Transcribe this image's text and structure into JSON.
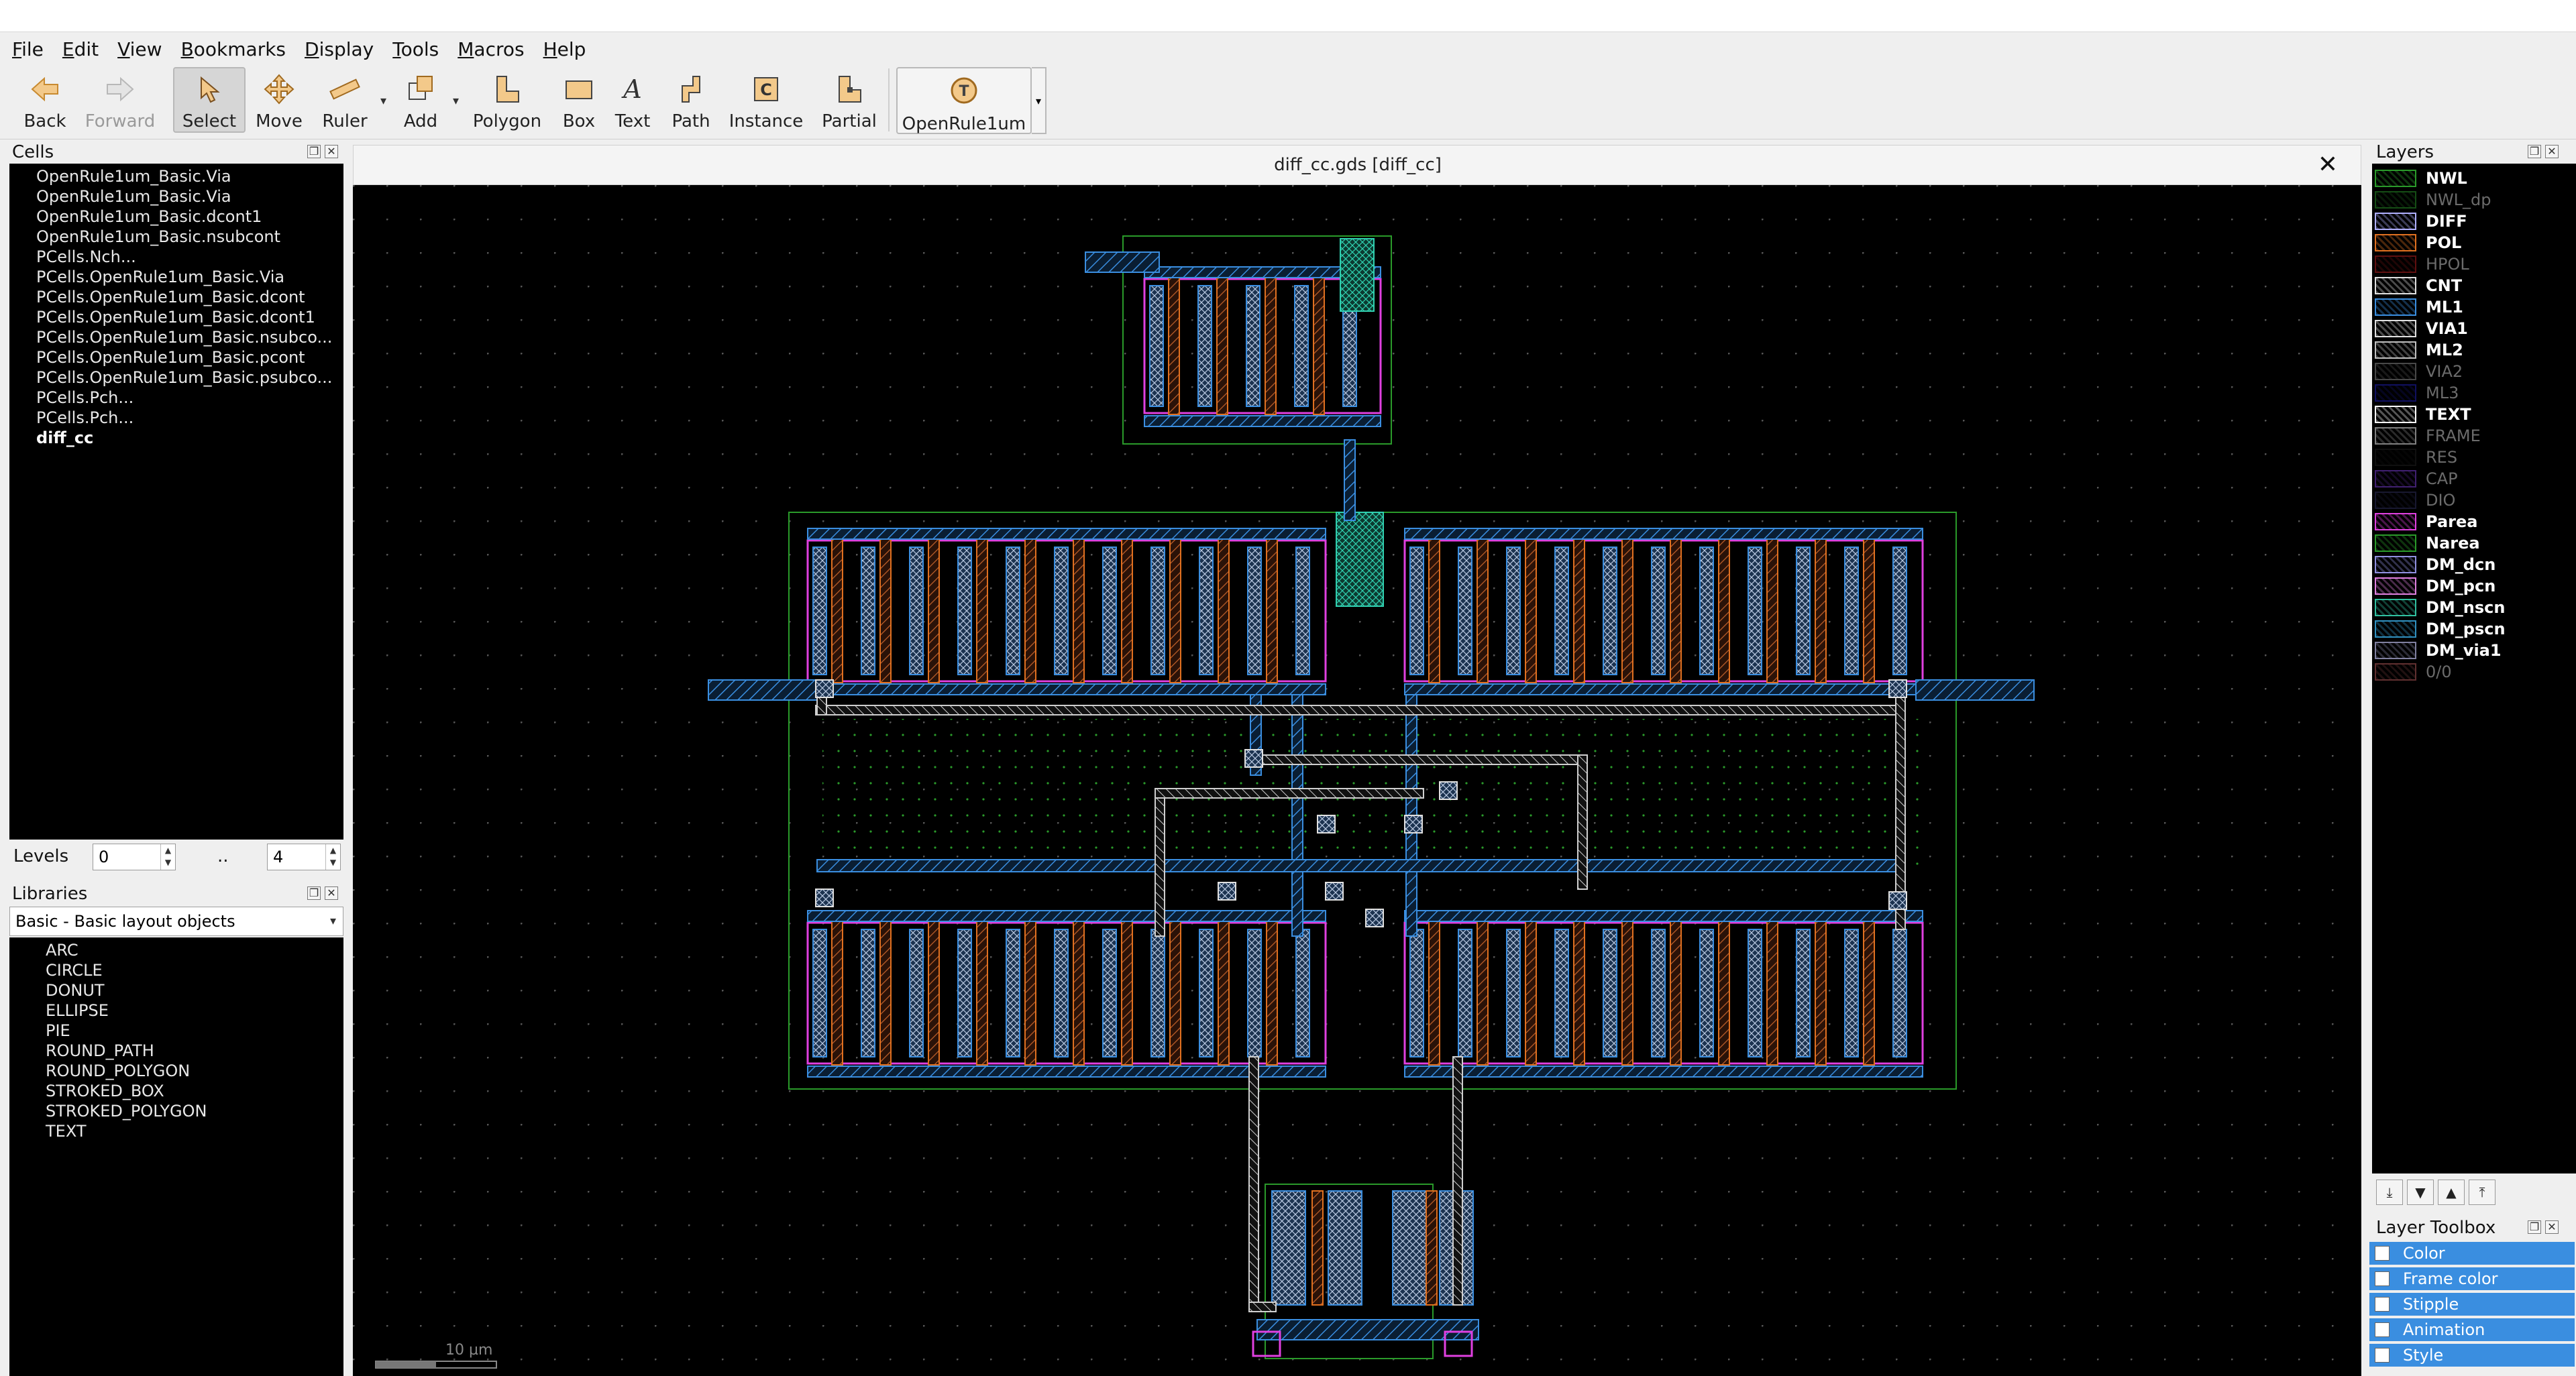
{
  "menu": [
    "File",
    "Edit",
    "View",
    "Bookmarks",
    "Display",
    "Tools",
    "Macros",
    "Help"
  ],
  "toolbar": {
    "back": "Back",
    "forward": "Forward",
    "select": "Select",
    "move": "Move",
    "ruler": "Ruler",
    "add": "Add",
    "polygon": "Polygon",
    "box": "Box",
    "text": "Text",
    "path": "Path",
    "instance": "Instance",
    "partial": "Partial",
    "tech": "OpenRule1um"
  },
  "cells_panel": {
    "title": "Cells",
    "items": [
      "OpenRule1um_Basic.Via",
      "OpenRule1um_Basic.Via",
      "OpenRule1um_Basic.dcont1",
      "OpenRule1um_Basic.nsubcont",
      "PCells.Nch...",
      "PCells.OpenRule1um_Basic.Via",
      "PCells.OpenRule1um_Basic.dcont",
      "PCells.OpenRule1um_Basic.dcont1",
      "PCells.OpenRule1um_Basic.nsubco...",
      "PCells.OpenRule1um_Basic.pcont",
      "PCells.OpenRule1um_Basic.psubco...",
      "PCells.Pch...",
      "PCells.Pch...",
      "diff_cc"
    ]
  },
  "levels": {
    "label": "Levels",
    "from": "0",
    "sep": "..",
    "to": "4"
  },
  "libraries": {
    "title": "Libraries",
    "selected": "Basic - Basic layout objects",
    "items": [
      "ARC",
      "CIRCLE",
      "DONUT",
      "ELLIPSE",
      "PIE",
      "ROUND_PATH",
      "ROUND_POLYGON",
      "STROKED_BOX",
      "STROKED_POLYGON",
      "TEXT"
    ]
  },
  "view": {
    "title": "diff_cc.gds [diff_cc]",
    "scale_label": "10 µm"
  },
  "layers_panel": {
    "title": "Layers",
    "layers": [
      {
        "name": "NWL",
        "color": "#2a9a2a",
        "visible": true
      },
      {
        "name": "NWL_dp",
        "color": "#2a9a2a",
        "visible": false
      },
      {
        "name": "DIFF",
        "color": "#b0b0ff",
        "visible": true
      },
      {
        "name": "POL",
        "color": "#e07020",
        "visible": true
      },
      {
        "name": "HPOL",
        "color": "#c02020",
        "visible": false
      },
      {
        "name": "CNT",
        "color": "#e0e0e0",
        "visible": true
      },
      {
        "name": "ML1",
        "color": "#3a8ee0",
        "visible": true
      },
      {
        "name": "VIA1",
        "color": "#e0e0e0",
        "visible": true
      },
      {
        "name": "ML2",
        "color": "#c0c0c0",
        "visible": true
      },
      {
        "name": "VIA2",
        "color": "#909090",
        "visible": false
      },
      {
        "name": "ML3",
        "color": "#2020c0",
        "visible": false
      },
      {
        "name": "TEXT",
        "color": "#ffffff",
        "visible": true
      },
      {
        "name": "FRAME",
        "color": "#ffffff",
        "visible": false
      },
      {
        "name": "RES",
        "color": "#202020",
        "visible": false
      },
      {
        "name": "CAP",
        "color": "#8040e0",
        "visible": false
      },
      {
        "name": "DIO",
        "color": "#303060",
        "visible": false
      },
      {
        "name": "Parea",
        "color": "#e040e0",
        "visible": true
      },
      {
        "name": "Narea",
        "color": "#2a9a2a",
        "visible": true
      },
      {
        "name": "DM_dcn",
        "color": "#9090e0",
        "visible": true
      },
      {
        "name": "DM_pcn",
        "color": "#e080e0",
        "visible": true
      },
      {
        "name": "DM_nscn",
        "color": "#30c0a0",
        "visible": true
      },
      {
        "name": "DM_pscn",
        "color": "#3090c0",
        "visible": true
      },
      {
        "name": "DM_via1",
        "color": "#8080a0",
        "visible": true
      },
      {
        "name": "0/0",
        "color": "#c06060",
        "visible": false
      }
    ]
  },
  "layer_toolbox": {
    "title": "Layer Toolbox",
    "items": [
      "Color",
      "Frame color",
      "Stipple",
      "Animation",
      "Style"
    ]
  }
}
